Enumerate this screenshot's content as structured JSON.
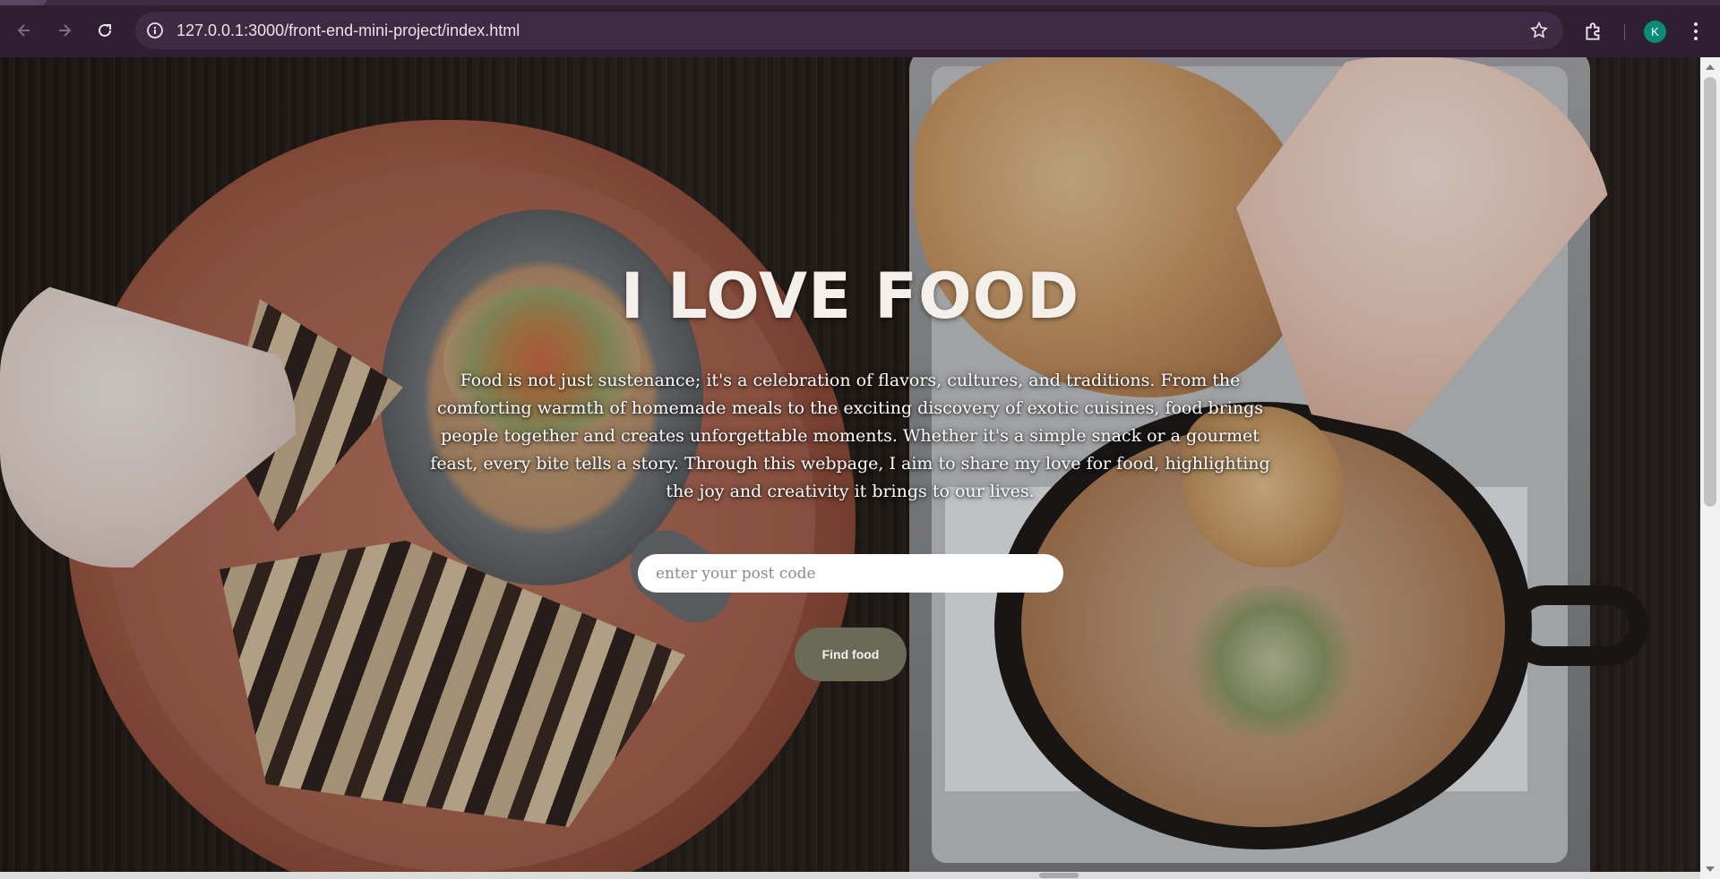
{
  "browser": {
    "url": "127.0.0.1:3000/front-end-mini-project/index.html",
    "profile_initial": "K",
    "profile_color": "#0d8a76",
    "icons": {
      "back": "arrow-left-icon",
      "forward": "arrow-right-icon",
      "reload": "reload-icon",
      "site_info": "info-icon",
      "bookmark": "star-icon",
      "extensions": "puzzle-icon",
      "menu": "more-vertical-icon"
    }
  },
  "hero": {
    "title": "I LOVE FOOD",
    "description": "Food is not just sustenance; it's a celebration of flavors, cultures, and traditions. From the comforting warmth of homemade meals to the exciting discovery of exotic cuisines, food brings people together and creates unforgettable moments. Whether it's a simple snack or a gourmet feast, every bite tells a story. Through this webpage, I aim to share my love for food, highlighting the joy and creativity it brings to our lives.",
    "postcode_placeholder": "enter your post code",
    "postcode_value": "",
    "button_label": "Find food"
  },
  "colors": {
    "chrome_bg": "#2e2030",
    "omnibox_bg": "#3e2b43",
    "button_bg": "#6b6a59",
    "title_color": "#f4efe9"
  }
}
